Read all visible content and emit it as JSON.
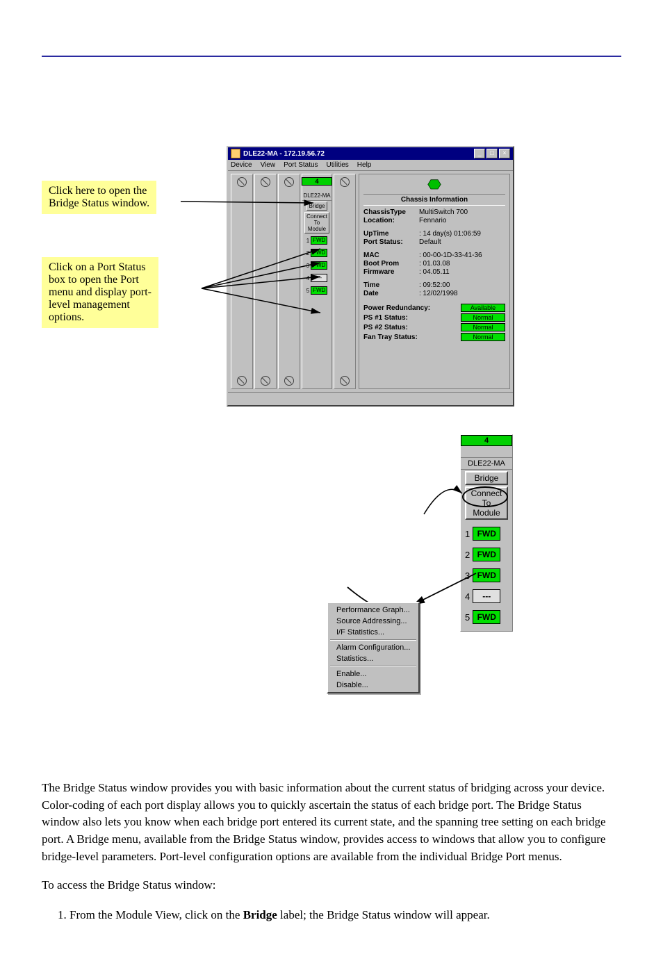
{
  "window": {
    "title": "DLE22-MA - 172.19.56.72",
    "menubar": [
      "Device",
      "View",
      "Port Status",
      "Utilities",
      "Help"
    ],
    "module": {
      "slot_number": "4",
      "name": "DLE22-MA",
      "bridge_btn": "Bridge",
      "connect_btn": "Connect\nTo\nModule",
      "ports": [
        {
          "num": "1",
          "label": "FWD",
          "on": true
        },
        {
          "num": "2",
          "label": "FWD",
          "on": true
        },
        {
          "num": "3",
          "label": "FWD",
          "on": true
        },
        {
          "num": "4",
          "label": "---",
          "on": false
        },
        {
          "num": "5",
          "label": "FWD",
          "on": true
        }
      ]
    },
    "chassis": {
      "title": "Chassis Information",
      "rows1": [
        {
          "lab": "ChassisType",
          "val": "MultiSwitch 700"
        },
        {
          "lab": "Location:",
          "val": "Fennario"
        }
      ],
      "rows2": [
        {
          "lab": "UpTime",
          "val": ": 14 day(s) 01:06:59"
        },
        {
          "lab": "Port Status:",
          "val": "Default"
        }
      ],
      "rows3": [
        {
          "lab": "MAC",
          "val": ": 00-00-1D-33-41-36"
        },
        {
          "lab": "Boot Prom",
          "val": ": 01.03.08"
        },
        {
          "lab": "Firmware",
          "val": ": 04.05.11"
        }
      ],
      "rows4": [
        {
          "lab": "Time",
          "val": ": 09:52:00"
        },
        {
          "lab": "Date",
          "val": ": 12/02/1998"
        }
      ],
      "status": [
        {
          "lab": "Power Redundancy:",
          "val": "Available"
        },
        {
          "lab": "PS #1 Status:",
          "val": "Normal"
        },
        {
          "lab": "PS #2 Status:",
          "val": "Normal"
        },
        {
          "lab": "Fan Tray Status:",
          "val": "Normal"
        }
      ]
    }
  },
  "hints": {
    "h1": "Click here to open the\nBridge Status window.",
    "h2": "Click on a Port Status\nbox to open the Port\nmenu and display port-\nlevel management\noptions."
  },
  "detail": {
    "slot_number": "4",
    "name": "DLE22-MA",
    "bridge": "Bridge",
    "connect": "Connect\nTo\nModule",
    "ports": [
      {
        "num": "1",
        "label": "FWD",
        "on": true
      },
      {
        "num": "2",
        "label": "FWD",
        "on": true
      },
      {
        "num": "3",
        "label": "FWD",
        "on": true
      },
      {
        "num": "4",
        "label": "---",
        "on": false
      },
      {
        "num": "5",
        "label": "FWD",
        "on": true
      }
    ]
  },
  "ctx_menu": {
    "g1": [
      "Performance Graph...",
      "Source Addressing...",
      "I/F Statistics..."
    ],
    "g2": [
      "Alarm Configuration...",
      "Statistics..."
    ],
    "g3": [
      "Enable...",
      "Disable..."
    ]
  },
  "body_text": {
    "p1": "The Bridge Status window provides you with basic information about the current status of bridging across your device. Color-coding of each port display allows you to quickly ascertain the status of each bridge port. The Bridge Status window also lets you know when each bridge port entered its current state, and the spanning tree setting on each bridge port. A Bridge menu, available from the Bridge Status window, provides access to windows that allow you to configure bridge-level parameters. Port-level configuration options are available from the individual Bridge Port menus.",
    "p2": "To access the Bridge Status window:",
    "step": "From the Module View, click on the Bridge label; the Bridge Status window will appear.",
    "boldBridge": "Bridge"
  }
}
